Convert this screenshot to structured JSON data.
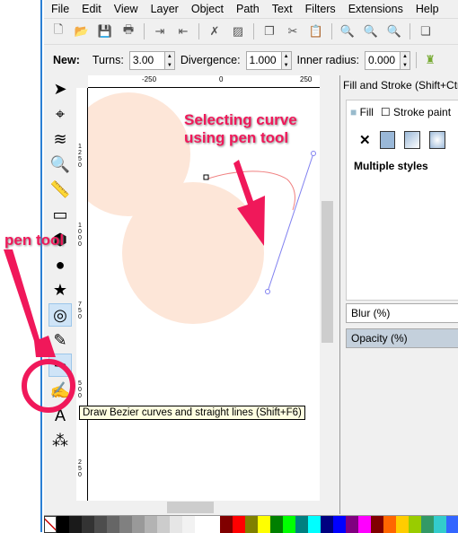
{
  "menu": [
    "File",
    "Edit",
    "View",
    "Layer",
    "Object",
    "Path",
    "Text",
    "Filters",
    "Extensions",
    "Help"
  ],
  "toolbar_icons": [
    "new-icon",
    "open-icon",
    "save-icon",
    "print-icon",
    "import-icon",
    "export-icon",
    "delete-icon",
    "clear-icon",
    "duplicate-icon",
    "cut-icon",
    "paste-icon",
    "zoom-selection-icon",
    "zoom-drawing-icon",
    "zoom-page-icon",
    "clone-icon"
  ],
  "controls": {
    "new_label": "New:",
    "turns_label": "Turns:",
    "turns": "3.00",
    "divergence_label": "Divergence:",
    "divergence": "1.000",
    "inner_radius_label": "Inner radius:",
    "inner_radius": "0.000"
  },
  "rulers": {
    "h": [
      "-250",
      "0",
      "250"
    ],
    "v": [
      "1250",
      "1000",
      "750",
      "500",
      "250"
    ]
  },
  "tools": [
    "selector",
    "node",
    "tweak",
    "zoom",
    "measure",
    "rectangle",
    "3d-box",
    "ellipse",
    "star",
    "spiral",
    "pencil",
    "pen",
    "calligraphy",
    "text",
    "spray"
  ],
  "tooltip": "Draw Bezier curves and straight lines (Shift+F6)",
  "annotations": {
    "title": "Selecting curve\nusing pen tool",
    "pen": "pen tool"
  },
  "panel": {
    "title": "Fill and Stroke (Shift+Ctrl+F)",
    "tab_fill": "Fill",
    "tab_stroke": "Stroke paint",
    "multiple": "Multiple styles",
    "blur": "Blur (%)",
    "opacity": "Opacity (%)"
  },
  "colors": {
    "accent": "#f0185a",
    "circle": "#fde6d8",
    "curve": "#f08080",
    "handle": "#8080f0"
  },
  "palette": [
    "#000000",
    "#1a1a1a",
    "#333333",
    "#4d4d4d",
    "#666666",
    "#808080",
    "#999999",
    "#b3b3b3",
    "#cccccc",
    "#e6e6e6",
    "#f2f2f2",
    "#ffffff",
    "#ffffff",
    "#800000",
    "#ff0000",
    "#808000",
    "#ffff00",
    "#008000",
    "#00ff00",
    "#008080",
    "#00ffff",
    "#000080",
    "#0000ff",
    "#800080",
    "#ff00ff",
    "#800000",
    "#ff6600",
    "#ffcc00",
    "#99cc00",
    "#339966",
    "#33cccc",
    "#3366ff"
  ]
}
